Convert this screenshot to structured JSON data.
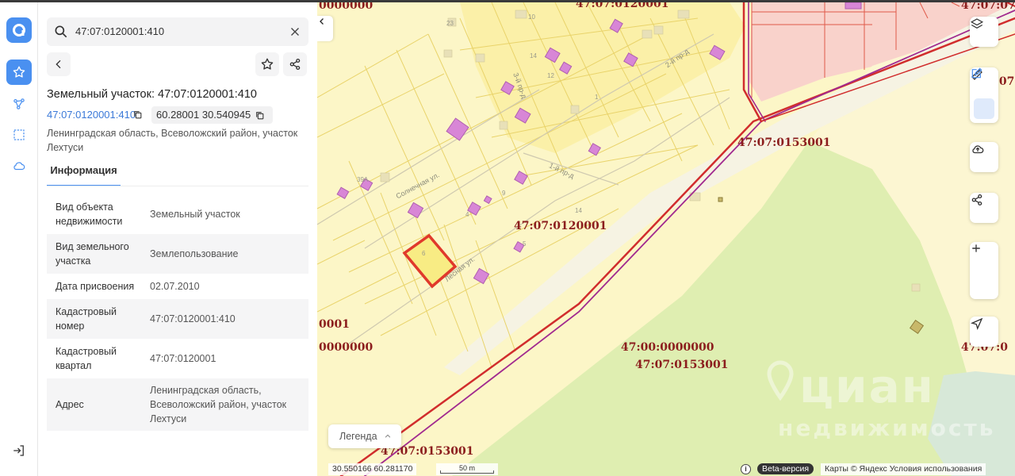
{
  "search": {
    "value": "47:07:0120001:410"
  },
  "object": {
    "title": "Земельный участок: 47:07:0120001:410",
    "cadastral_link": "47:07:0120001:410",
    "coordinates": "60.28001 30.540945",
    "address": "Ленинградская область, Всеволожский район, участок Лехтуси"
  },
  "tabs": [
    {
      "label": "Информация"
    }
  ],
  "info_rows": [
    {
      "key": "Вид объекта недвижимости",
      "value": "Земельный участок"
    },
    {
      "key": "Вид земельного участка",
      "value": "Землепользование"
    },
    {
      "key": "Дата присвоения",
      "value": "02.07.2010"
    },
    {
      "key": "Кадастровый номер",
      "value": "47:07:0120001:410"
    },
    {
      "key": "Кадастровый квартал",
      "value": "47:07:0120001"
    },
    {
      "key": "Адрес",
      "value": "Ленинградская область, Всеволожский район, участок Лехтуси"
    }
  ],
  "map": {
    "quarter_labels": {
      "q1": "0000000",
      "q2": "47:07:0120001",
      "q3": "47:07:07",
      "q4": "0:07",
      "q5": "47:07:0153001",
      "q6": "47:07:0120001",
      "q7": "0001",
      "q8": "0000000",
      "q9": "47:00:0000000",
      "q10": "47:07:0153001",
      "q11": "47:07:0",
      "q12": "47:07:0153001"
    },
    "streets": {
      "s1": "Солнечная ул.",
      "s2": "Лесная ул.",
      "s3": "1-й пр-д",
      "s4": "2-й пр-д",
      "s5": "3-й пр-д"
    },
    "plot_numbers": {
      "n1": "23",
      "n2": "10",
      "n3": "14",
      "n4": "12",
      "n5": "39А",
      "n6": "9",
      "n7": "4",
      "n8": "6",
      "n9": "14",
      "n10": "1",
      "n11": "5"
    },
    "legend": "Легенда",
    "cursor_coords": "30.550166  60.281170",
    "scale": "50 m",
    "info_glyph": "i",
    "beta": "Beta-версия",
    "copyright": "Карты © Яндекс   Условия использования",
    "watermark_main": "циан",
    "watermark_sub": "недвижимость"
  },
  "colors": {
    "accent": "#4a90f0",
    "map_bg": "#fcf6c7",
    "forest": "#dfeeb1",
    "building": "#d886d6",
    "quarter_line": "#d12d2d",
    "selection": "#e0392b"
  }
}
